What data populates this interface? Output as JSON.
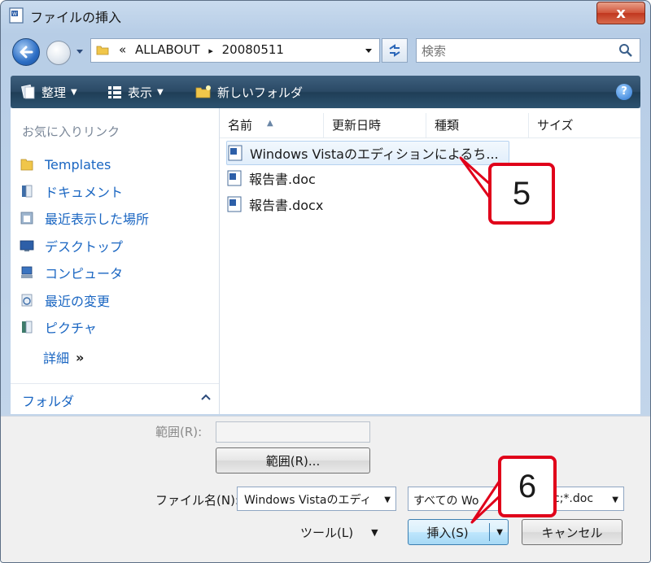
{
  "window": {
    "title": "ファイルの挿入",
    "close_glyph": "x"
  },
  "address": {
    "breadcrumbs": [
      "«",
      "ALLABOUT",
      "▸",
      "20080511"
    ],
    "search_placeholder": "検索"
  },
  "toolbar": {
    "organize": "整理",
    "views": "表示",
    "new_folder": "新しいフォルダ",
    "help": "?"
  },
  "nav": {
    "favorites_header": "お気に入りリンク",
    "items": [
      {
        "label": "Templates",
        "icon": "folder-icon"
      },
      {
        "label": "ドキュメント",
        "icon": "documents-icon"
      },
      {
        "label": "最近表示した場所",
        "icon": "recent-places-icon"
      },
      {
        "label": "デスクトップ",
        "icon": "desktop-icon"
      },
      {
        "label": "コンピュータ",
        "icon": "computer-icon"
      },
      {
        "label": "最近の変更",
        "icon": "recent-changes-icon"
      },
      {
        "label": "ピクチャ",
        "icon": "pictures-icon"
      }
    ],
    "details": "詳細",
    "details_chevron": "»",
    "folders": "フォルダ"
  },
  "files": {
    "columns": [
      "名前",
      "更新日時",
      "種類",
      "サイズ"
    ],
    "rows": [
      {
        "name": "Windows Vistaのエディションによるち...",
        "selected": true
      },
      {
        "name": "報告書.doc",
        "selected": false
      },
      {
        "name": "報告書.docx",
        "selected": false
      }
    ]
  },
  "bottom": {
    "range_label": "範囲(R):",
    "range_button": "範囲(R)...",
    "filename_label": "ファイル名(N):",
    "filename_value": "Windows Vistaのエディ",
    "filetype_value_left": "すべての Wo",
    "filetype_value_right": "c;*.doc",
    "tools_label": "ツール(L)",
    "insert_button": "挿入(S)",
    "cancel_button": "キャンセル"
  },
  "callouts": {
    "step5": "5",
    "step6": "6"
  },
  "colors": {
    "accent": "#1a66c2",
    "callout_red": "#e0001a",
    "command_bar": "#2b4a66"
  }
}
